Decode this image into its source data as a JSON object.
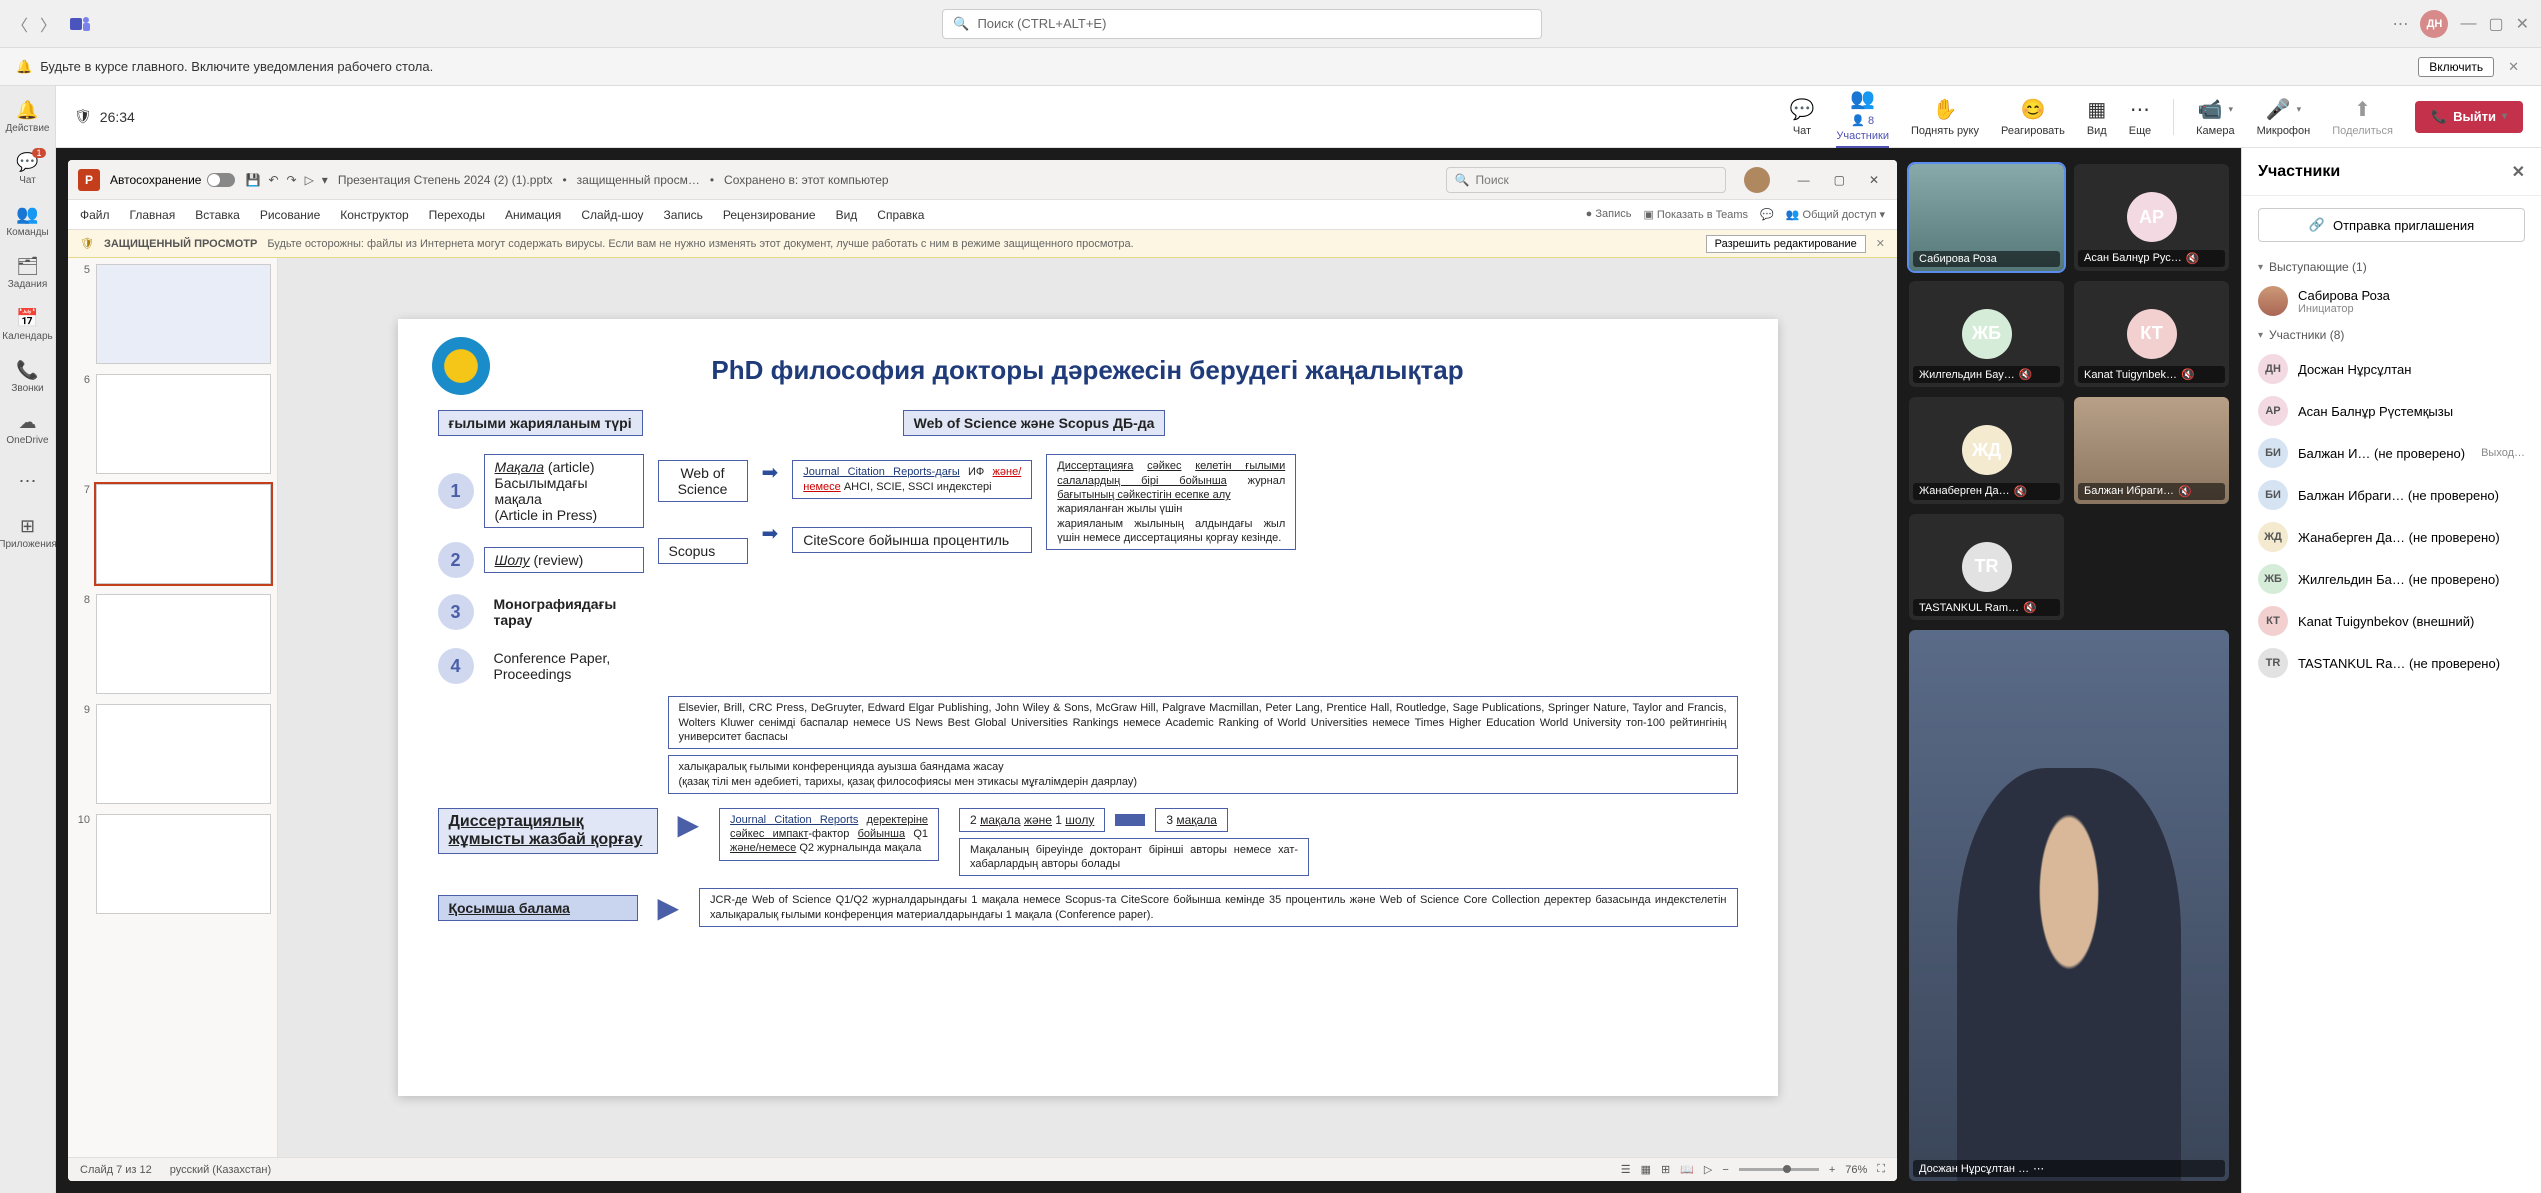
{
  "titlebar": {
    "search_placeholder": "Поиск (CTRL+ALT+E)",
    "avatar_initials": "ДН"
  },
  "notification": {
    "text": "Будьте в курсе главного. Включите уведомления рабочего стола.",
    "enable": "Включить"
  },
  "rail": [
    {
      "label": "Действие",
      "icon": "bell-icon"
    },
    {
      "label": "Чат",
      "icon": "chat-icon",
      "badge": "1"
    },
    {
      "label": "Команды",
      "icon": "teams-icon"
    },
    {
      "label": "Задания",
      "icon": "assign-icon"
    },
    {
      "label": "Календарь",
      "icon": "calendar-icon"
    },
    {
      "label": "Звонки",
      "icon": "calls-icon"
    },
    {
      "label": "OneDrive",
      "icon": "onedrive-icon"
    },
    {
      "label": "",
      "icon": "more-icon"
    },
    {
      "label": "Приложения",
      "icon": "apps-icon"
    }
  ],
  "meeting": {
    "timer": "26:34",
    "controls": {
      "chat": "Чат",
      "people": "Участники",
      "people_count": "8",
      "raise": "Поднять руку",
      "react": "Реагировать",
      "view": "Вид",
      "more": "Еще",
      "camera": "Камера",
      "mic": "Микрофон",
      "share": "Поделиться",
      "leave": "Выйти"
    }
  },
  "ppt": {
    "autosave": "Автосохранение",
    "filename": "Презентация Степень  2024 (2) (1).pptx",
    "protected_tag": "защищенный просм…",
    "saved": "Сохранено в: этот компьютер",
    "search": "Поиск",
    "ribbon": [
      "Файл",
      "Главная",
      "Вставка",
      "Рисование",
      "Конструктор",
      "Переходы",
      "Анимация",
      "Слайд-шоу",
      "Запись",
      "Рецензирование",
      "Вид",
      "Справка"
    ],
    "right_tools": {
      "record": "Запись",
      "present": "Показать в Teams",
      "share": "Общий доступ"
    },
    "protected": {
      "label": "ЗАЩИЩЕННЫЙ ПРОСМОТР",
      "msg": "Будьте осторожны: файлы из Интернета могут содержать вирусы. Если вам не нужно изменять этот документ, лучше работать с ним в режиме защищенного просмотра.",
      "button": "Разрешить редактирование"
    },
    "thumbs": [
      "5",
      "6",
      "7",
      "8",
      "9",
      "10"
    ],
    "status": {
      "slide": "Слайд 7 из 12",
      "lang": "русский (Казахстан)",
      "zoom": "76%"
    }
  },
  "slide": {
    "title": "PhD философия докторы дәрежесін берудегі жаңалықтар",
    "pub_type_hdr": "ғылыми жарияланым түрі",
    "db_hdr": "Web of Science және Scopus ДБ-да",
    "item1": "Мақала (article) Басылымдағы мақала (Article in Press)",
    "item1_word": "Мақала",
    "item1_rest": " (article)\nБасылымдағы мақала\n(Article in Press)",
    "item2": "Шолу (review)",
    "item2_word": "Шолу",
    "item2_rest": " (review)",
    "item3": "Монографиядағы тарау",
    "item4": "Conference Paper, Proceedings",
    "wos": "Web of Science",
    "scopus": "Scopus",
    "jcr": "Journal Citation Reports-дағы ИФ және/немесе AHCI, SCIE, SSCI индекстері",
    "citescore": "CiteScore бойынша процентиль",
    "right_note": "Диссертацияға сәйкес келетін ғылыми салалардың бірі бойынша журнал бағытының сәйкестігін есепке алу\nжарияланған жылы үшін\nжарияланым жылының алдындағы жыл үшін немесе диссертацияны қорғау кезінде.",
    "publishers": "Elsevier, Brill, CRC Press, DeGruyter, Edward Elgar Publishing, John Wiley & Sons, McGraw Hill, Palgrave Macmillan, Peter Lang, Prentice Hall, Routledge, Sage Publications, Springer Nature, Taylor and Francis, Wolters Kluwer сенімді баспалар немесе US News Best Global Universities Rankings немесе Academic Ranking of World Universities немесе Times Higher Education World University топ-100 рейтингінің университет баспасы",
    "conf": "халықаралық ғылыми конференцияда ауызша баяндама жасау\n(қазақ тілі мен әдебиеті, тарихы, қазақ философиясы мен этикасы мұғалімдерін даярлау)",
    "defense_hdr": "Диссертациялық жұмысты жазбай қорғау",
    "jcr_req": "Journal Citation Reports деректеріне сәйкес импакт-фактор бойынша Q1 және/немесе Q2 журналында мақала",
    "req1": "2 мақала және 1 шолу",
    "req2": "3 мақала",
    "author_note": "Мақаланың біреуінде докторант бірінші авторы немесе хат-хабарлардың авторы болады",
    "alt_hdr": "Қосымша балама",
    "alt_text": "JCR-де Web of Science Q1/Q2 журналдарындағы 1 мақала немесе Scopus-та CiteScore бойынша кемінде 35 процентиль және Web of Science Core Collection деректер базасында индекстелетін халықаралық ғылыми конференция материалдарындағы 1 мақала (Conference paper)."
  },
  "tiles": [
    {
      "name": "Сабирова Роза",
      "type": "video",
      "speaking": true
    },
    {
      "name": "Асан Балнұр Рус…",
      "initials": "АР",
      "bg": "c-pink",
      "muted": true
    },
    {
      "name": "Жилгельдин Бау…",
      "initials": "ЖБ",
      "bg": "c-grn",
      "muted": true
    },
    {
      "name": "Kanat Tuigynbek…",
      "initials": "КТ",
      "bg": "c-red",
      "muted": true
    },
    {
      "name": "Жанаберген Да…",
      "initials": "ЖД",
      "bg": "c-yel",
      "muted": true
    },
    {
      "name": "Балжан Ибраги…",
      "type": "video",
      "muted": true
    },
    {
      "name": "TASTANKUL Ram…",
      "initials": "TR",
      "bg": "c-grey",
      "muted": true
    },
    {
      "name": "Досжан Нұрсұлтан …",
      "type": "video-large"
    }
  ],
  "panel": {
    "title": "Участники",
    "invite": "Отправка приглашения",
    "presenters_label": "Выступающие (1)",
    "presenter": {
      "name": "Сабирова Роза",
      "role": "Инициатор"
    },
    "participants_label": "Участники (8)",
    "list": [
      {
        "initials": "ДН",
        "name": "Досжан Нұрсұлтан",
        "status": "",
        "bg": "c-pink"
      },
      {
        "initials": "АР",
        "name": "Асан Балнұр Рүстемқызы",
        "status": "",
        "bg": "c-pink"
      },
      {
        "initials": "БИ",
        "name": "Балжан И…  (не проверено)",
        "status": "Выход…",
        "bg": "c-blu"
      },
      {
        "initials": "БИ",
        "name": "Балжан Ибраги…  (не проверено)",
        "status": "",
        "bg": "c-blu"
      },
      {
        "initials": "ЖД",
        "name": "Жанаберген Да…  (не проверено)",
        "status": "",
        "bg": "c-yel"
      },
      {
        "initials": "ЖБ",
        "name": "Жилгельдин Ба…  (не проверено)",
        "status": "",
        "bg": "c-grn"
      },
      {
        "initials": "КТ",
        "name": "Kanat Tuigynbekov  (внешний)",
        "status": "",
        "bg": "c-red"
      },
      {
        "initials": "TR",
        "name": "TASTANKUL Ra…  (не проверено)",
        "status": "",
        "bg": "c-grey"
      }
    ]
  }
}
